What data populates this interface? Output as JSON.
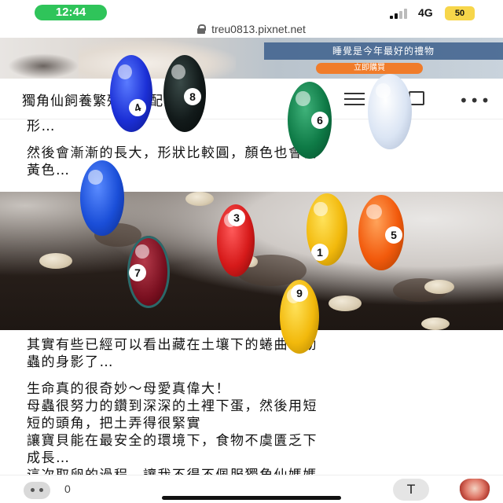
{
  "status_bar": {
    "time": "12:44",
    "network": "4G",
    "battery": "50"
  },
  "browser": {
    "url": "treu0813.pixnet.net"
  },
  "ad": {
    "slogan": "睡覺是今年最好的禮物",
    "cta": "立即購買"
  },
  "article": {
    "title": "獨角仙飼養繁殖分享配與…",
    "paragraphs": [
      "形…",
      "然後會漸漸的長大，形狀比較圓，顏色也會偏",
      "黃色…",
      "其實有些已經可以看出藏在土壤下的蜷曲小幼",
      "蟲的身影了…",
      "生命真的很奇妙～母愛真偉大！",
      "母蟲很努力的鑽到深深的土裡下蛋，然後用短",
      "短的頭角，把土弄得很緊實",
      "讓寶貝能在最安全的環境下，食物不虞匱乏下",
      "成長…",
      "這次取卵的過程，讓我不得不佩服獨角仙媽媽"
    ]
  },
  "balls": [
    "4",
    "8",
    "6",
    "",
    "",
    "3",
    "1",
    "5",
    "7",
    "9"
  ],
  "colors": {
    "green_pill": "#2fc45a",
    "ad_cta": "#f07c2a",
    "battery": "#f7d64a"
  },
  "bottom_bar": {
    "like_count": "0",
    "font_label": "T"
  }
}
